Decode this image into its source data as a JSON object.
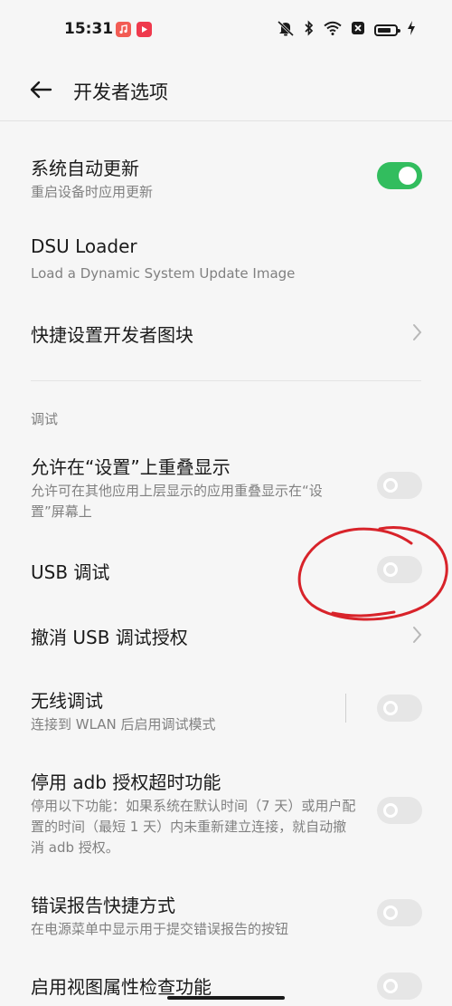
{
  "status_bar": {
    "time": "15:31",
    "battery_level": 0.8
  },
  "header": {
    "title": "开发者选项"
  },
  "items": [
    {
      "title": "系统自动更新",
      "subtitle": "重启设备时应用更新",
      "control": "toggle",
      "on": true
    },
    {
      "title": "DSU Loader",
      "subtitle": "Load a Dynamic System Update Image",
      "control": "none"
    },
    {
      "title": "快捷设置开发者图块",
      "subtitle": "",
      "control": "chevron"
    },
    {
      "title": "允许在“设置”上重叠显示",
      "subtitle": "允许可在其他应用上层显示的应用重叠显示在“设置”屏幕上",
      "control": "toggle",
      "on": false
    },
    {
      "title": "USB 调试",
      "subtitle": "",
      "control": "toggle",
      "on": false
    },
    {
      "title": "撤消 USB 调试授权",
      "subtitle": "",
      "control": "chevron"
    },
    {
      "title": "无线调试",
      "subtitle": "连接到 WLAN 后启用调试模式",
      "control": "toggle",
      "on": false
    },
    {
      "title": "停用 adb 授权超时功能",
      "subtitle": "停用以下功能：如果系统在默认时间（7 天）或用户配置的时间（最短 1 天）内未重新建立连接，就自动撤消 adb 授权。",
      "control": "toggle",
      "on": false
    },
    {
      "title": "错误报告快捷方式",
      "subtitle": "在电源菜单中显示用于提交错误报告的按钮",
      "control": "toggle",
      "on": false
    },
    {
      "title": "启用视图属性检查功能",
      "subtitle": "",
      "control": "toggle",
      "on": false
    }
  ],
  "section_header": "调试",
  "colors": {
    "accent_toggle_on": "#32bd5e",
    "annotation_red": "#d8232a"
  }
}
